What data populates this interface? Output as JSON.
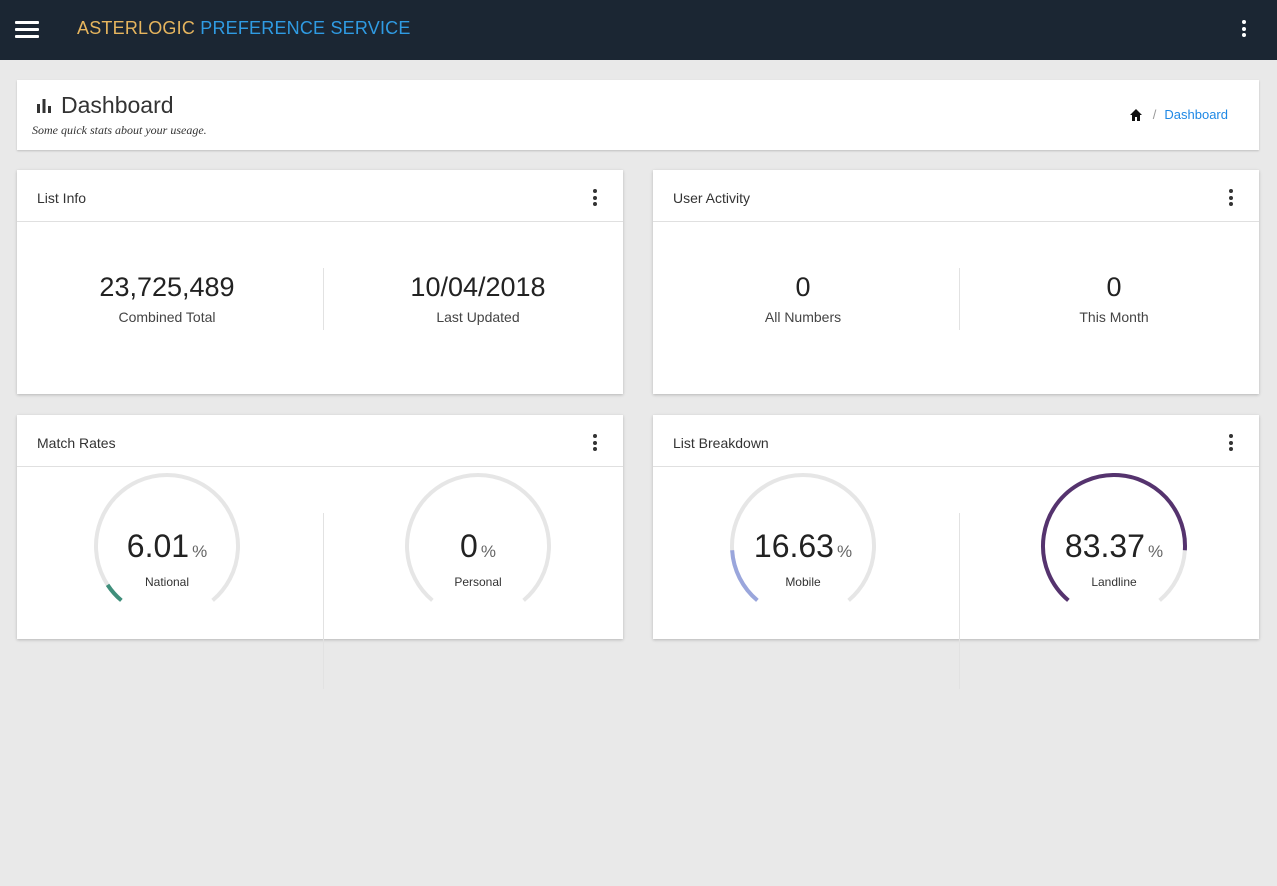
{
  "app": {
    "brand_part1": "ASTERLOGIC",
    "brand_part2": "PREFERENCE SERVICE"
  },
  "page": {
    "title": "Dashboard",
    "subtitle": "Some quick stats about your useage."
  },
  "breadcrumb": {
    "home_icon": "home-icon",
    "current": "Dashboard"
  },
  "colors": {
    "topbar": "#1b2633",
    "brand_accent_1": "#e6b55e",
    "brand_accent_2": "#2f9be3",
    "national": "#3f8f7b",
    "mobile": "#9aa6dc",
    "landline": "#55336e",
    "gauge_track": "#e6e6e6"
  },
  "list_info": {
    "title": "List Info",
    "combined_total": {
      "value": "23,725,489",
      "label": "Combined Total"
    },
    "last_updated": {
      "value": "10/04/2018",
      "label": "Last Updated"
    }
  },
  "user_activity": {
    "title": "User Activity",
    "all_numbers": {
      "value": "0",
      "label": "All Numbers"
    },
    "this_month": {
      "value": "0",
      "label": "This Month"
    }
  },
  "match_rates": {
    "title": "Match Rates",
    "national": {
      "value": "6.01",
      "unit": "%",
      "label": "National",
      "percent": 6.01
    },
    "personal": {
      "value": "0",
      "unit": "%",
      "label": "Personal",
      "percent": 0
    }
  },
  "list_breakdown": {
    "title": "List Breakdown",
    "mobile": {
      "value": "16.63",
      "unit": "%",
      "label": "Mobile",
      "percent": 16.63
    },
    "landline": {
      "value": "83.37",
      "unit": "%",
      "label": "Landline",
      "percent": 83.37
    }
  }
}
